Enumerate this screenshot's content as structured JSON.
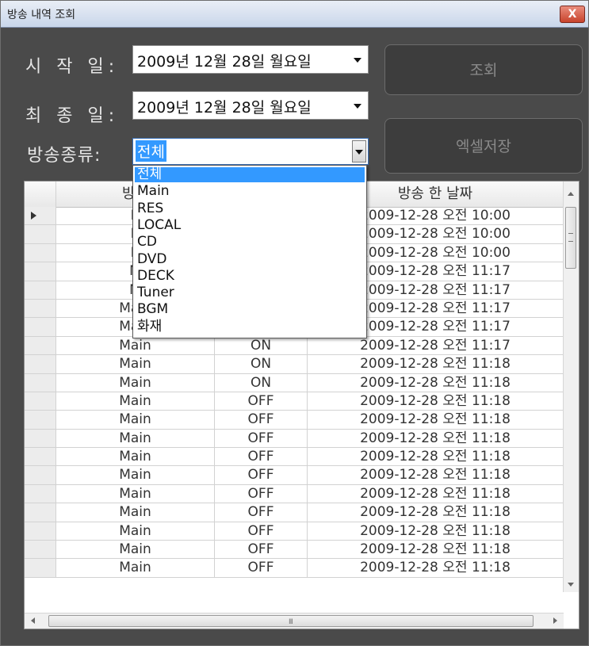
{
  "window": {
    "title": "방송 내역 조회",
    "close_label": "X"
  },
  "form": {
    "start_label": "시 작 일:",
    "end_label": "최 종 일:",
    "kind_label": "방송종류:",
    "start_date": "2009년 12월 28일 월요일",
    "end_date": "2009년 12월 28일 월요일",
    "kind_value": "전체",
    "query_button": "조회",
    "excel_button": "엑셀저장"
  },
  "dropdown": {
    "options": [
      "전체",
      "Main",
      "RES",
      "LOCAL",
      "CD",
      "DVD",
      "DECK",
      "Tuner",
      "BGM",
      "화재"
    ],
    "selected": "전체"
  },
  "grid": {
    "columns": [
      "방송",
      "",
      "방송 한 날짜"
    ],
    "rows": [
      {
        "source": "R",
        "state": "",
        "date": "2009-12-28 오전 10:00"
      },
      {
        "source": "R",
        "state": "",
        "date": "2009-12-28 오전 10:00"
      },
      {
        "source": "R",
        "state": "",
        "date": "2009-12-28 오전 10:00"
      },
      {
        "source": "M",
        "state": "",
        "date": "2009-12-28 오전 11:17"
      },
      {
        "source": "M",
        "state": "",
        "date": "2009-12-28 오전 11:17"
      },
      {
        "source": "Main",
        "state": "ON",
        "date": "2009-12-28 오전 11:17"
      },
      {
        "source": "Main",
        "state": "ON",
        "date": "2009-12-28 오전 11:17"
      },
      {
        "source": "Main",
        "state": "ON",
        "date": "2009-12-28 오전 11:17"
      },
      {
        "source": "Main",
        "state": "ON",
        "date": "2009-12-28 오전 11:18"
      },
      {
        "source": "Main",
        "state": "ON",
        "date": "2009-12-28 오전 11:18"
      },
      {
        "source": "Main",
        "state": "OFF",
        "date": "2009-12-28 오전 11:18"
      },
      {
        "source": "Main",
        "state": "OFF",
        "date": "2009-12-28 오전 11:18"
      },
      {
        "source": "Main",
        "state": "OFF",
        "date": "2009-12-28 오전 11:18"
      },
      {
        "source": "Main",
        "state": "OFF",
        "date": "2009-12-28 오전 11:18"
      },
      {
        "source": "Main",
        "state": "OFF",
        "date": "2009-12-28 오전 11:18"
      },
      {
        "source": "Main",
        "state": "OFF",
        "date": "2009-12-28 오전 11:18"
      },
      {
        "source": "Main",
        "state": "OFF",
        "date": "2009-12-28 오전 11:18"
      },
      {
        "source": "Main",
        "state": "OFF",
        "date": "2009-12-28 오전 11:18"
      },
      {
        "source": "Main",
        "state": "OFF",
        "date": "2009-12-28 오전 11:18"
      },
      {
        "source": "Main",
        "state": "OFF",
        "date": "2009-12-28 오전 11:18"
      }
    ],
    "hscroll_grip": "III"
  }
}
